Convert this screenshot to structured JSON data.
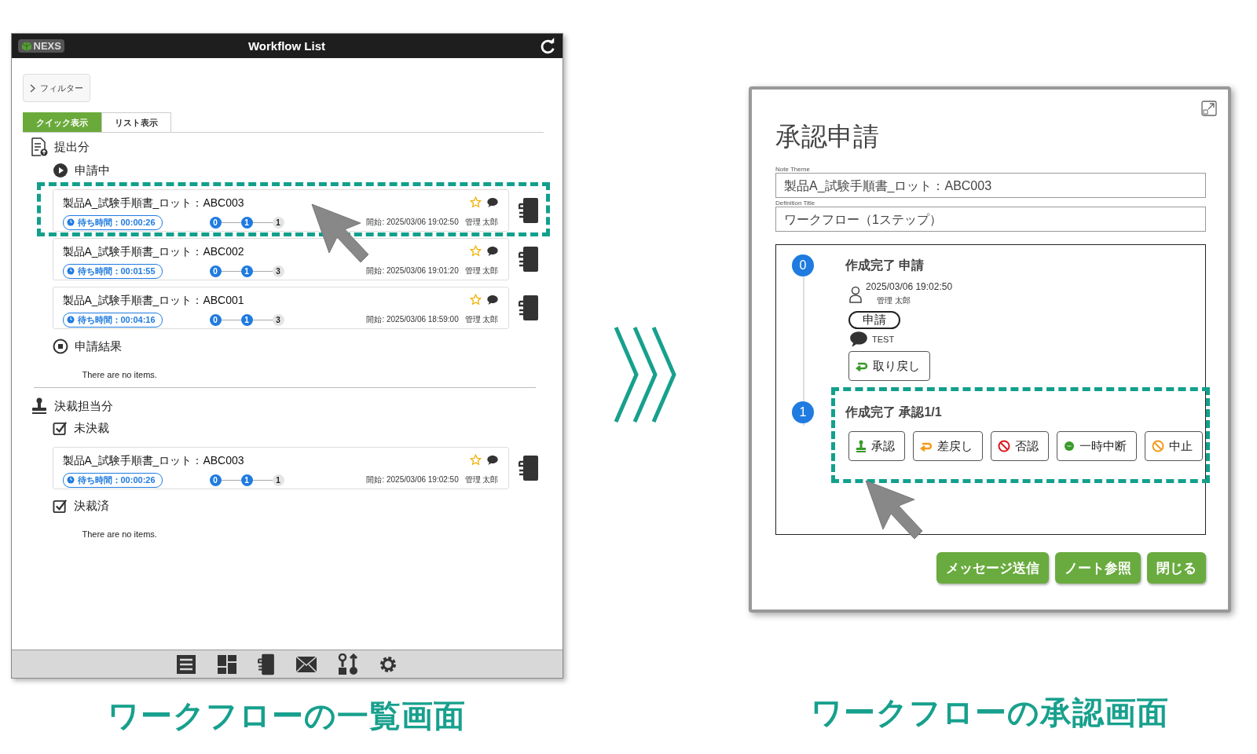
{
  "list_screen": {
    "logo": "NEXS",
    "title": "Workflow List",
    "filter": "フィルター",
    "tabs": [
      {
        "label": "クイック表示",
        "selected": true
      },
      {
        "label": "リスト表示",
        "selected": false
      }
    ],
    "sections": [
      {
        "heading": "提出分",
        "kind": "submitted",
        "groups": [
          {
            "heading": "申請中",
            "kind": "in-progress",
            "items": [
              {
                "title": "製品A_試験手順書_ロット：ABC003",
                "wait": "待ち時間：00:00:26",
                "steps": [
                  {
                    "label": "0",
                    "done": true
                  },
                  {
                    "label": "1",
                    "done": true
                  },
                  {
                    "label": "1",
                    "done": false
                  }
                ],
                "started": "開始: 2025/03/06 19:02:50",
                "user": "管理 太郎",
                "highlighted": true
              },
              {
                "title": "製品A_試験手順書_ロット：ABC002",
                "wait": "待ち時間：00:01:55",
                "steps": [
                  {
                    "label": "0",
                    "done": true
                  },
                  {
                    "label": "1",
                    "done": true
                  },
                  {
                    "label": "3",
                    "done": false
                  }
                ],
                "started": "開始: 2025/03/06 19:01:20",
                "user": "管理 太郎",
                "highlighted": false
              },
              {
                "title": "製品A_試験手順書_ロット：ABC001",
                "wait": "待ち時間：00:04:16",
                "steps": [
                  {
                    "label": "0",
                    "done": true
                  },
                  {
                    "label": "1",
                    "done": true
                  },
                  {
                    "label": "3",
                    "done": false
                  }
                ],
                "started": "開始: 2025/03/06 18:59:00",
                "user": "管理 太郎",
                "highlighted": false
              }
            ]
          },
          {
            "heading": "申請結果",
            "kind": "result",
            "empty": "There are no items."
          }
        ]
      },
      {
        "heading": "決裁担当分",
        "kind": "approver",
        "groups": [
          {
            "heading": "未決裁",
            "kind": "pending",
            "items": [
              {
                "title": "製品A_試験手順書_ロット：ABC003",
                "wait": "待ち時間：00:00:26",
                "steps": [
                  {
                    "label": "0",
                    "done": true
                  },
                  {
                    "label": "1",
                    "done": true
                  },
                  {
                    "label": "1",
                    "done": false
                  }
                ],
                "started": "開始: 2025/03/06 19:02:50",
                "user": "管理 太郎",
                "highlighted": false
              }
            ]
          },
          {
            "heading": "決裁済",
            "kind": "decided",
            "empty": "There are no items."
          }
        ]
      }
    ]
  },
  "list_caption": "ワークフローの一覧画面",
  "approval_dialog": {
    "title": "承認申請",
    "fields": [
      {
        "label": "Note Theme",
        "value": "製品A_試験手順書_ロット：ABC003"
      },
      {
        "label": "Definition Title",
        "value": "ワークフロー（1ステップ）"
      }
    ],
    "steps": [
      {
        "number": "0",
        "title": "作成完了 申請",
        "datetime": "2025/03/06 19:02:50",
        "user": "管理 太郎",
        "badge": "申請",
        "comment": "TEST",
        "highlighted": false,
        "actions": [
          {
            "label": "取り戻し",
            "kind": "withdraw"
          }
        ]
      },
      {
        "number": "1",
        "title": "作成完了 承認1/1",
        "highlighted": true,
        "actions": [
          {
            "label": "承認",
            "kind": "approve"
          },
          {
            "label": "差戻し",
            "kind": "remand"
          },
          {
            "label": "否認",
            "kind": "reject"
          },
          {
            "label": "一時中断",
            "kind": "suspend"
          },
          {
            "label": "中止",
            "kind": "cancel"
          }
        ]
      }
    ],
    "footer_buttons": [
      "メッセージ送信",
      "ノート参照",
      "閉じる"
    ]
  },
  "approval_caption": "ワークフローの承認画面"
}
